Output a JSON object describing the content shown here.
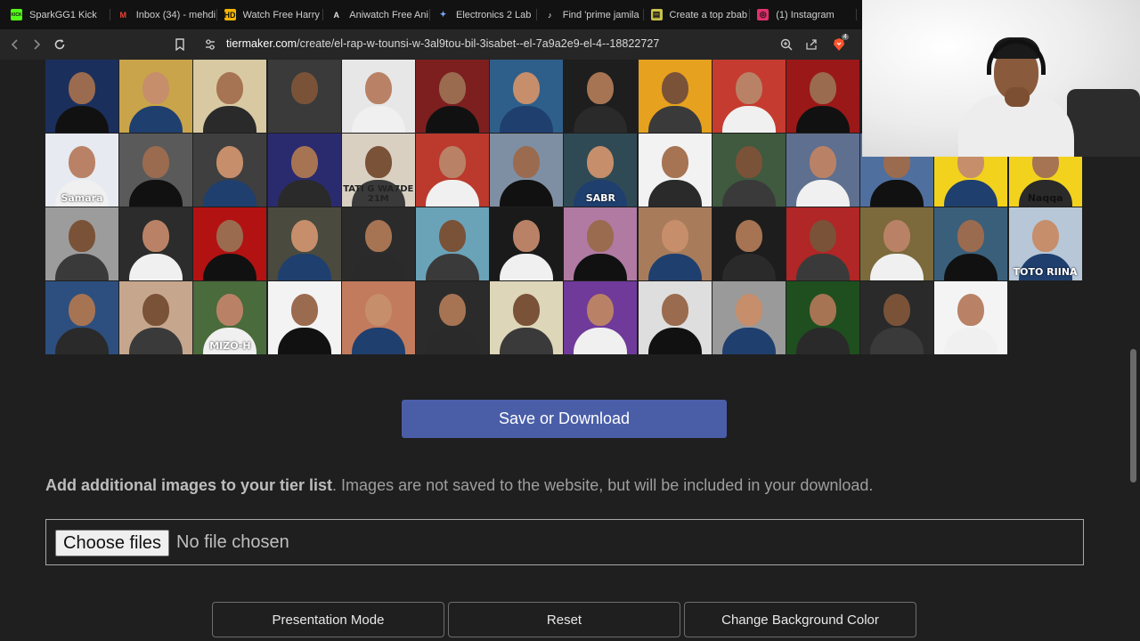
{
  "browser": {
    "tabs": [
      {
        "title": "SparkGG1 Kick",
        "favicon": "kick-icon",
        "color": "#53fc18",
        "glyph": "KICK"
      },
      {
        "title": "Inbox (34) - mehdi",
        "favicon": "gmail-icon",
        "color": "#ea4335",
        "glyph": "M"
      },
      {
        "title": "Watch Free Harry",
        "favicon": "hd-icon",
        "color": "#f5b400",
        "glyph": "HD"
      },
      {
        "title": "Aniwatch Free Ani",
        "favicon": "aniwatch-icon",
        "color": "#e0e0e0",
        "glyph": "A"
      },
      {
        "title": "Electronics 2 Lab",
        "favicon": "gemini-icon",
        "color": "#7aa7ff",
        "glyph": "✦"
      },
      {
        "title": "Find 'prime jamila",
        "favicon": "tiktok-icon",
        "color": "#ffffff",
        "glyph": "♪"
      },
      {
        "title": "Create a top zbab",
        "favicon": "tiermaker-icon",
        "color": "#c9c24a",
        "glyph": "▤"
      },
      {
        "title": "(1) Instagram",
        "favicon": "instagram-icon",
        "color": "#e1306c",
        "glyph": "◎"
      }
    ],
    "url_host": "tiermaker.com",
    "url_path": "/create/el-rap-w-tounsi-w-3al9tou-bil-3isabet--el-7a9a2e9-el-4--18822727",
    "brave_badge": "4"
  },
  "tiles": {
    "captions": {
      "r1c0": "Samara",
      "r1c4": "TATI G WA7DE 21M",
      "r1c7": "SABR",
      "r1c13": "Naqqa",
      "r2c13": "TOTO RIINA",
      "r3c2": "MIZO-H"
    }
  },
  "actions": {
    "save_label": "Save or Download",
    "add_images_bold": "Add additional images to your tier list",
    "add_images_rest": ". Images are not saved to the website, but will be included in your download.",
    "choose_files_label": "Choose files",
    "file_status": "No file chosen",
    "presentation_label": "Presentation Mode",
    "reset_label": "Reset",
    "change_bg_label": "Change Background Color"
  }
}
